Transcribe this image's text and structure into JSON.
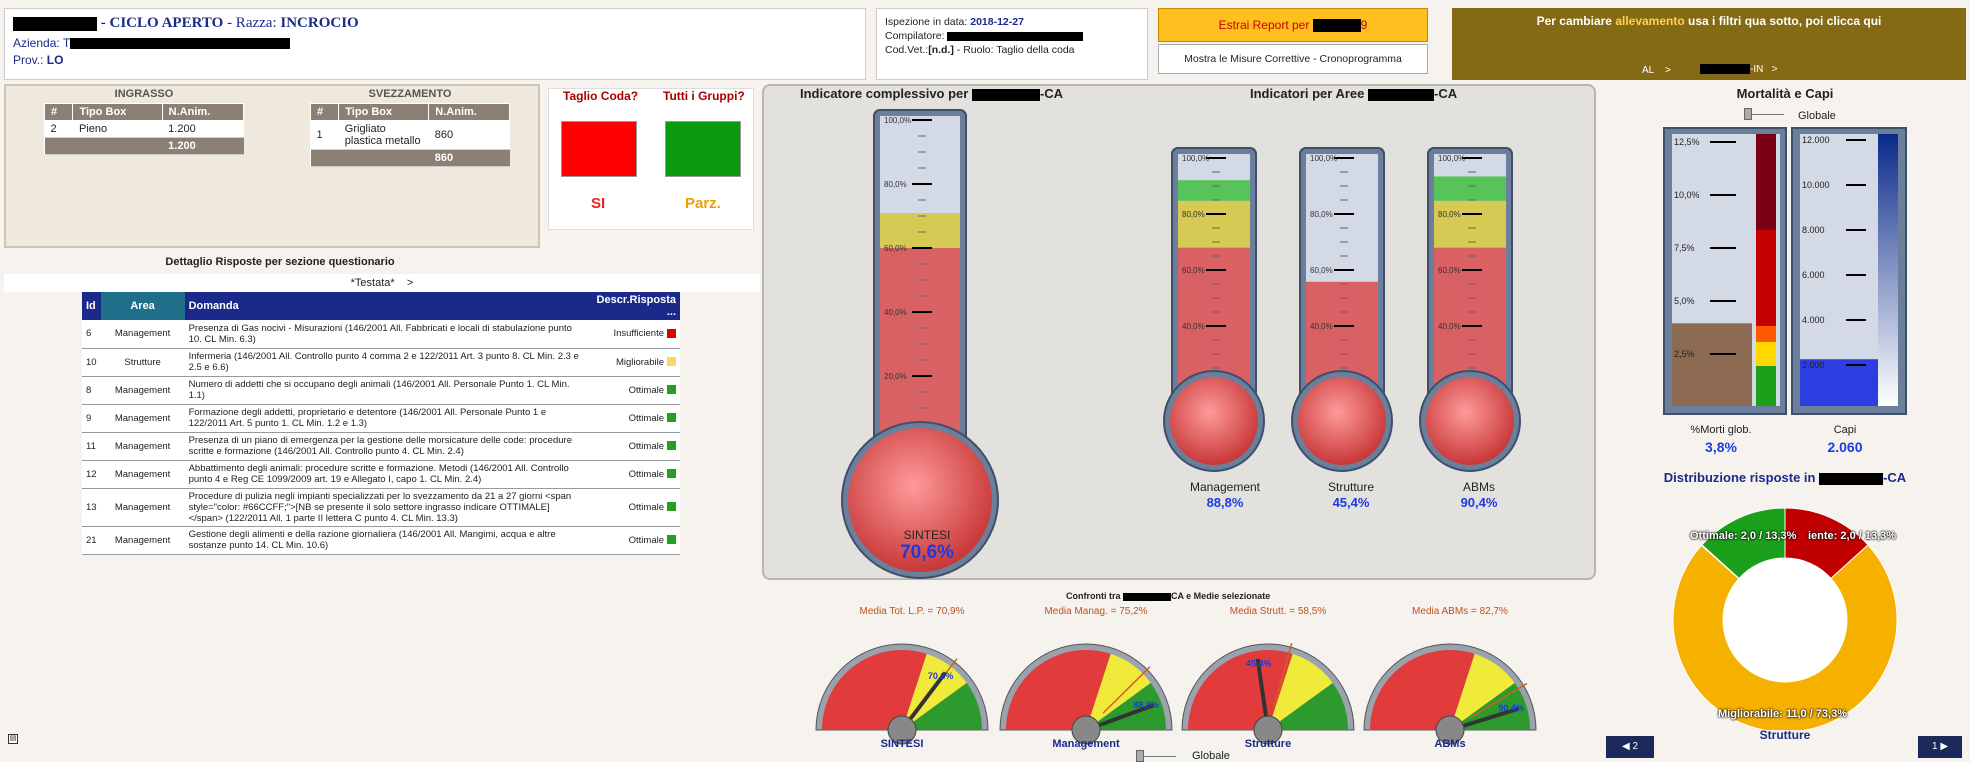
{
  "header": {
    "title_suffix": "- CICLO APERTO",
    "razza_label": "- Razza:",
    "razza_value": "INCROCIO",
    "azienda_label": "Azienda:",
    "azienda_prefix": "T",
    "prov_label": "Prov.:",
    "prov_value": "LO",
    "ispezione_label": "Ispezione in data:",
    "ispezione_date": "2018-12-27",
    "compilatore_label": "Compilatore:",
    "codvet_label": "Cod.Vet.:",
    "codvet_value": "[n.d.]",
    "ruolo_text": "- Ruolo: Taglio della coda",
    "report_btn": "Estrai Report per",
    "report_btn_suffix": "9",
    "misure_btn": "Mostra le Misure Correttive - Cronoprogramma",
    "farm_msg_a": "Per cambiare ",
    "farm_msg_b": "allevamento",
    "farm_msg_c": " usa i filtri qua sotto, poi clicca qui",
    "filter_al": "AL",
    "filter_suffix": "-IN"
  },
  "ingrasso": {
    "title": "INGRASSO",
    "cols": [
      "#",
      "Tipo Box",
      "N.Anim."
    ],
    "rows": [
      [
        "2",
        "Pieno",
        "1.200"
      ]
    ],
    "total": "1.200"
  },
  "svezzamento": {
    "title": "SVEZZAMENTO",
    "cols": [
      "#",
      "Tipo Box",
      "N.Anim."
    ],
    "rows": [
      [
        "1",
        "Grigliato plastica metallo",
        "860"
      ]
    ],
    "total": "860"
  },
  "taglio": {
    "label": "Taglio Coda?",
    "value": "SI",
    "color": "#ff1a1a"
  },
  "gruppi": {
    "label": "Tutti i Gruppi?",
    "value": "Parz.",
    "color": "#009a17"
  },
  "detail": {
    "title": "Dettaglio Risposte per sezione questionario",
    "section": "*Testata*",
    "cols": [
      "Id",
      "Area",
      "Domanda",
      "Descr.Risposta ..."
    ],
    "rows": [
      {
        "id": "6",
        "area": "Management",
        "q": "Presenza di Gas nocivi - Misurazioni (146/2001 All. Fabbricati e locali di stabulazione punto 10. CL Min. 6.3)",
        "r": "Insufficiente",
        "c": "#e00000"
      },
      {
        "id": "10",
        "area": "Strutture",
        "q": "Infermeria (146/2001 All. Controllo punto 4 comma 2 e 122/2011 Art. 3 punto 8. CL Min. 2.3 e 2.5 e 6.6)",
        "r": "Migliorabile",
        "c": "#f5d76e"
      },
      {
        "id": "8",
        "area": "Management",
        "q": "Numero di addetti che si occupano degli animali (146/2001 All. Personale Punto 1. CL Min. 1.1)",
        "r": "Ottimale",
        "c": "#22a022"
      },
      {
        "id": "9",
        "area": "Management",
        "q": "Formazione degli addetti, proprietario e detentore (146/2001 All. Personale Punto 1 e 122/2011 Art. 5 punto 1. CL Min. 1.2 e 1.3)",
        "r": "Ottimale",
        "c": "#22a022"
      },
      {
        "id": "11",
        "area": "Management",
        "q": "Presenza di un piano di emergenza per la gestione delle morsicature delle code: procedure scritte e formazione (146/2001 All. Controllo punto 4. CL Min. 2.4)",
        "r": "Ottimale",
        "c": "#22a022"
      },
      {
        "id": "12",
        "area": "Management",
        "q": "Abbattimento degli animali: procedure scritte e formazione. Metodi (146/2001 All. Controllo punto 4 e Reg CE 1099/2009 art. 19 e Allegato I, capo 1. CL Min. 2.4)",
        "r": "Ottimale",
        "c": "#22a022"
      },
      {
        "id": "13",
        "area": "Management",
        "q": "Procedure di pulizia negli impianti specializzati per lo svezzamento da 21 a 27 giorni <span style=\"color: #66CCFF;\">[NB se presente il solo settore ingrasso indicare OTTIMALE] </span> (122/2011 All. 1 parte II lettera C punto 4. CL Min. 13.3)",
        "r": "Ottimale",
        "c": "#22a022"
      },
      {
        "id": "21",
        "area": "Management",
        "q": "Gestione degli alimenti e della razione giornaliera (146/2001 All. Mangimi, acqua e altre sostanze punto 14. CL Min. 10.6)",
        "r": "Ottimale",
        "c": "#22a022"
      }
    ]
  },
  "thermo_main": {
    "title": "Indicatore complessivo per",
    "title_suffix": "-CA",
    "label": "SINTESI",
    "value": "70,6%",
    "fill": 0.706,
    "ticks": [
      "100,0%",
      "80,0%",
      "60,0%",
      "40,0%",
      "20,0%"
    ]
  },
  "thermo_areas": {
    "title": "Indicatori per Aree",
    "title_suffix": "-CA",
    "items": [
      {
        "label": "Management",
        "value": "88,8%",
        "fill": 0.888
      },
      {
        "label": "Strutture",
        "value": "45,4%",
        "fill": 0.454
      },
      {
        "label": "ABMs",
        "value": "90,4%",
        "fill": 0.904
      }
    ],
    "ticks": [
      "100,0%",
      "80,0%",
      "60,0%",
      "40,0%",
      "20,0%"
    ]
  },
  "compare": {
    "title_a": "Confronti tra",
    "title_b": "CA e Medie selezionate"
  },
  "gauges": [
    {
      "label": "SINTESI",
      "avg_label": "Media Tot. L.P. = 70,9%",
      "value": "70,6%",
      "val": 0.706,
      "avg": 0.709
    },
    {
      "label": "Management",
      "avg_label": "Media Manag. = 75,2%",
      "value": "88,8%",
      "val": 0.888,
      "avg": 0.752
    },
    {
      "label": "Strutture",
      "avg_label": "Media Strutt. = 58,5%",
      "value": "45,4%",
      "val": 0.454,
      "avg": 0.585
    },
    {
      "label": "ABMs",
      "avg_label": "Media ABMs = 82,7%",
      "value": "90,4%",
      "val": 0.904,
      "avg": 0.827
    }
  ],
  "mortality": {
    "title": "Mortalità e Capi",
    "toggle": "Globale",
    "morti_ticks": [
      "12,5%",
      "10,0%",
      "7,5%",
      "5,0%",
      "2,5%"
    ],
    "capi_ticks": [
      "12.000",
      "10.000",
      "8.000",
      "6.000",
      "4.000",
      "2.000"
    ],
    "morti_label": "%Morti glob.",
    "morti_value": "3,8%",
    "morti_fill": 0.304,
    "capi_label": "Capi",
    "capi_value": "2.060",
    "capi_fill": 0.172
  },
  "donut": {
    "title": "Distribuzione risposte in",
    "title_suffix": "-CA",
    "segments": [
      {
        "name": "Ottimale",
        "count": "2,0",
        "pct": "13,3%",
        "frac": 0.133,
        "color": "#1aa01a"
      },
      {
        "name": "Insufficiente",
        "count": "2,0",
        "pct": "13,3%",
        "frac": 0.133,
        "color": "#c00000"
      },
      {
        "name": "Migliorabile",
        "count": "11,0",
        "pct": "73,3%",
        "frac": 0.733,
        "color": "#f5b000"
      }
    ],
    "label_left": "Ottimale: 2,0 / 13,3%",
    "label_right": "iente: 2,0 / 13,3%",
    "label_bottom": "Migliorabile: 11,0 / 73,3%",
    "caption": "Strutture"
  },
  "bottom": {
    "toggle": "Globale",
    "prev": "2",
    "next": "1"
  }
}
